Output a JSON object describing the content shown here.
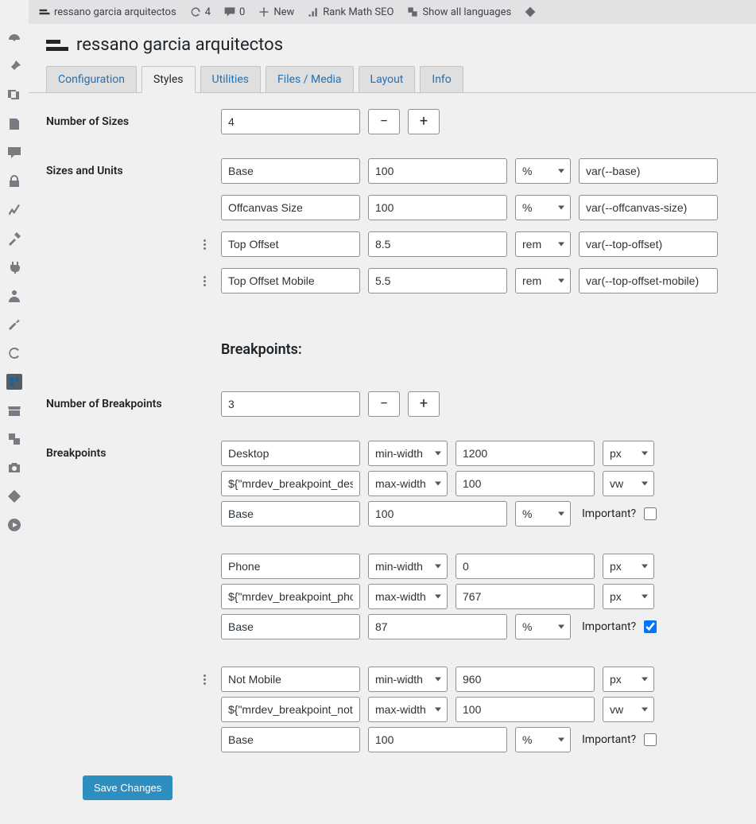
{
  "topbar": {
    "site_title": "ressano garcia arquitectos",
    "updates_count": "4",
    "comments_count": "0",
    "new_label": "New",
    "rankmath_label": "Rank Math SEO",
    "langs_label": "Show all languages"
  },
  "page_title": "ressano garcia arquitectos",
  "tabs": {
    "config": "Configuration",
    "styles": "Styles",
    "utilities": "Utilities",
    "files": "Files / Media",
    "layout": "Layout",
    "info": "Info"
  },
  "labels": {
    "num_sizes": "Number of Sizes",
    "sizes_units": "Sizes and Units",
    "breakpoints_title": "Breakpoints:",
    "num_breakpoints": "Number of Breakpoints",
    "breakpoints": "Breakpoints",
    "important": "Important?"
  },
  "num_sizes": "4",
  "sizes": [
    {
      "name": "Base",
      "value": "100",
      "unit": "%",
      "var": "var(--base)",
      "drag": false
    },
    {
      "name": "Offcanvas Size",
      "value": "100",
      "unit": "%",
      "var": "var(--offcanvas-size)",
      "drag": false
    },
    {
      "name": "Top Offset",
      "value": "8.5",
      "unit": "rem",
      "var": "var(--top-offset)",
      "drag": true
    },
    {
      "name": "Top Offset Mobile",
      "value": "5.5",
      "unit": "rem",
      "var": "var(--top-offset-mobile)",
      "drag": true
    }
  ],
  "num_breakpoints": "3",
  "breakpoints": [
    {
      "name": "Desktop",
      "min_cond": "min-width",
      "min_val": "1200",
      "min_unit": "px",
      "var_name": "${\"mrdev_breakpoint_desktop\"}",
      "max_cond": "max-width",
      "max_val": "100",
      "max_unit": "vw",
      "base_name": "Base",
      "base_val": "100",
      "base_unit": "%",
      "important": false,
      "drag": false
    },
    {
      "name": "Phone",
      "min_cond": "min-width",
      "min_val": "0",
      "min_unit": "px",
      "var_name": "${\"mrdev_breakpoint_phone\"}",
      "max_cond": "max-width",
      "max_val": "767",
      "max_unit": "px",
      "base_name": "Base",
      "base_val": "87",
      "base_unit": "%",
      "important": true,
      "drag": false
    },
    {
      "name": "Not Mobile",
      "min_cond": "min-width",
      "min_val": "960",
      "min_unit": "px",
      "var_name": "${\"mrdev_breakpoint_notmobile\"}",
      "max_cond": "max-width",
      "max_val": "100",
      "max_unit": "vw",
      "base_name": "Base",
      "base_val": "100",
      "base_unit": "%",
      "important": false,
      "drag": true
    }
  ],
  "save_label": "Save Changes"
}
